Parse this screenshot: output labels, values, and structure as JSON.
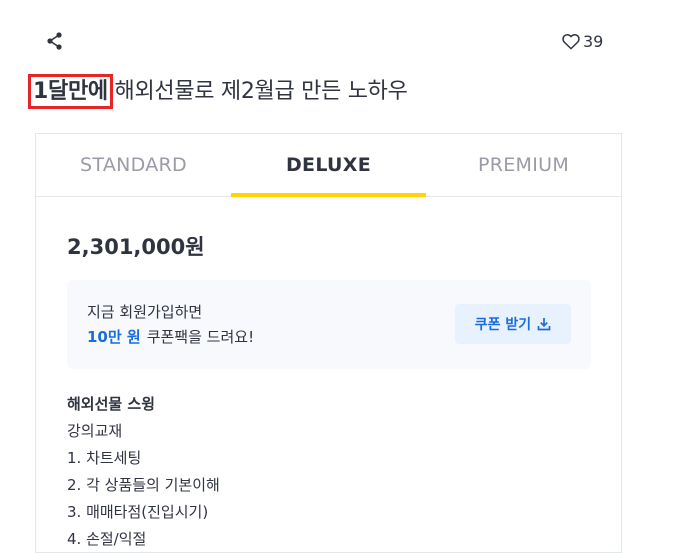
{
  "header": {
    "like_count": "39",
    "title_highlight": "1달만에",
    "title_rest": " 해외선물로 제2월급 만든 노하우"
  },
  "package_tabs": [
    {
      "label": "STANDARD",
      "active": false
    },
    {
      "label": "DELUXE",
      "active": true
    },
    {
      "label": "PREMIUM",
      "active": false
    }
  ],
  "price": "2,301,000원",
  "coupon": {
    "line1": "지금 회원가입하면",
    "amount": "10만 원",
    "line2_rest": "쿠폰팩을 드려요!",
    "button_label": "쿠폰 받기"
  },
  "description": {
    "heading": "해외선물 스윙",
    "lines": [
      "강의교재",
      "1. 차트세팅",
      "2. 각 상품들의 기본이해",
      "3. 매매타점(진입시기)",
      "4. 손절/익절"
    ]
  },
  "colors": {
    "accent_yellow": "#ffd400",
    "accent_blue": "#1a6de0",
    "highlight_red": "#e62626"
  }
}
